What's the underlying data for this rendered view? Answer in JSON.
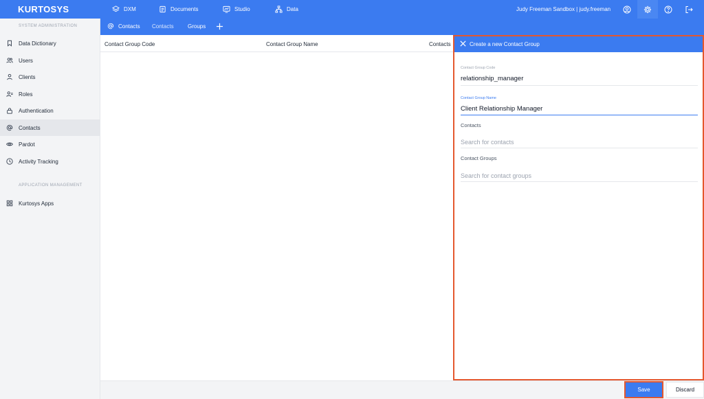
{
  "app": {
    "logo": "KURTOSYS"
  },
  "topnav": [
    {
      "label": "DXM",
      "icon": "layers-icon"
    },
    {
      "label": "Documents",
      "icon": "documents-icon"
    },
    {
      "label": "Studio",
      "icon": "studio-icon"
    },
    {
      "label": "Data",
      "icon": "hierarchy-icon"
    }
  ],
  "user": {
    "text": "Judy Freeman Sandbox  |  judy.freeman"
  },
  "subnav": {
    "contacts_active": "Contacts",
    "contacts": "Contacts",
    "groups": "Groups"
  },
  "sidebar": {
    "heading_system": "SYSTEM ADMINISTRATION",
    "heading_app": "APPLICATION MANAGEMENT",
    "items": [
      {
        "label": "Data Dictionary",
        "icon": "bookmark-icon"
      },
      {
        "label": "Users",
        "icon": "users-icon"
      },
      {
        "label": "Clients",
        "icon": "user-icon"
      },
      {
        "label": "Roles",
        "icon": "user-roles-icon"
      },
      {
        "label": "Authentication",
        "icon": "lock-icon"
      },
      {
        "label": "Contacts",
        "icon": "at-icon"
      },
      {
        "label": "Pardot",
        "icon": "eye-icon"
      },
      {
        "label": "Activity Tracking",
        "icon": "clock-icon"
      }
    ],
    "app_items": [
      {
        "label": "Kurtosys Apps",
        "icon": "grid-icon"
      }
    ]
  },
  "table": {
    "columns": [
      "Contact Group Code",
      "Contact Group Name",
      "Contacts"
    ]
  },
  "panel": {
    "title": "Create a new Contact Group",
    "code_label": "Contact Group Code",
    "code_value": "relationship_manager",
    "name_label": "Contact Group Name",
    "name_value": "Client Relationship Manager",
    "contacts_label": "Contacts",
    "contacts_placeholder": "Search for contacts",
    "groups_label": "Contact Groups",
    "groups_placeholder": "Search for contact groups"
  },
  "buttons": {
    "save": "Save",
    "discard": "Discard"
  },
  "colors": {
    "brand": "#3b7bf0",
    "highlight": "#e4572e"
  }
}
